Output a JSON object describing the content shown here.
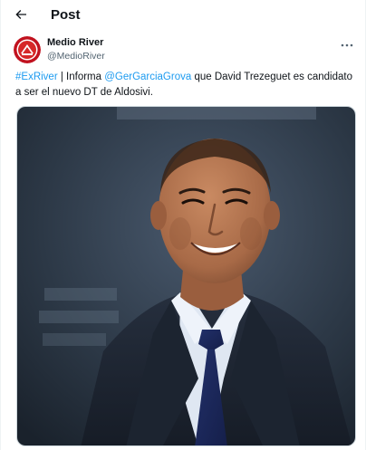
{
  "header": {
    "title": "Post",
    "back_icon": "arrow-left-icon"
  },
  "post": {
    "author_name": "Medio River",
    "author_handle": "@MedioRiver",
    "avatar_icon": "river-logo-icon",
    "more_icon": "more-horizontal-icon",
    "text_parts": [
      {
        "type": "hashtag",
        "text": "#ExRiver"
      },
      {
        "type": "text",
        "text": " | Informa "
      },
      {
        "type": "mention",
        "text": "@GerGarciaGrova"
      },
      {
        "type": "text",
        "text": " que David Trezeguet es candidato a ser el nuevo DT de Aldosivi."
      }
    ],
    "media": {
      "kind": "photo"
    }
  },
  "colors": {
    "link": "#1d9bf0",
    "text_primary": "#0f1419",
    "text_secondary": "#536471",
    "avatar_red": "#d62828"
  }
}
